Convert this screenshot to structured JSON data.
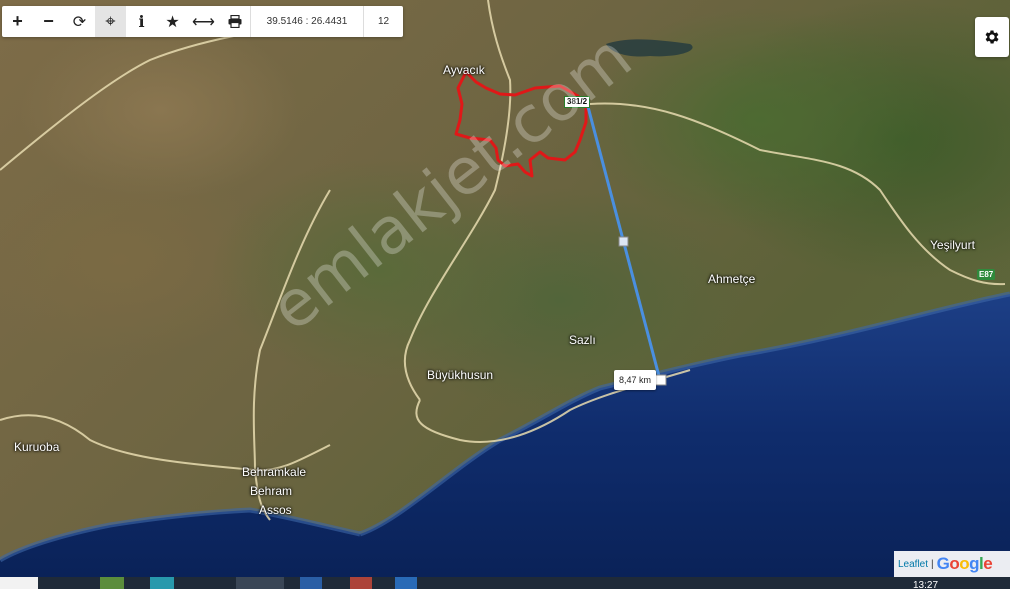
{
  "toolbar": {
    "zoom_in_icon": "+",
    "zoom_out_icon": "−",
    "refresh_icon": "⟳",
    "locate_icon": "⌖",
    "info_icon": "i",
    "favorite_icon": "★",
    "measure_icon": "⟷",
    "print_icon": "⎙",
    "coordinates": "39.5146 : 26.4431",
    "zoom_level": "12"
  },
  "settings": {
    "icon": "gear-icon"
  },
  "places": {
    "ayvacik": "Ayvacık",
    "yesilyurt": "Yeşilyurt",
    "ahmetce": "Ahmetçe",
    "sazli": "Sazlı",
    "buyukhusun": "Büyükhusun",
    "kuruoba": "Kuruoba",
    "behramkale": "Behramkale",
    "behram": "Behram",
    "assos": "Assos"
  },
  "roads": {
    "route_381": "381/2",
    "e87": "E87"
  },
  "measurement": {
    "distance": "8,47 km"
  },
  "watermark": "emlakjet.com",
  "attribution": {
    "leaflet": "Leaflet",
    "separator": "|",
    "google": "Google"
  },
  "taskbar": {
    "clock": "13:27"
  },
  "colors": {
    "sea": "#0c2a66",
    "boundary": "#e01818",
    "measure_line": "#4a8fe0",
    "road": "#e8dcb0",
    "google_blue": "#4285F4",
    "google_red": "#EA4335",
    "google_yellow": "#FBBC05",
    "google_green": "#34A853"
  }
}
